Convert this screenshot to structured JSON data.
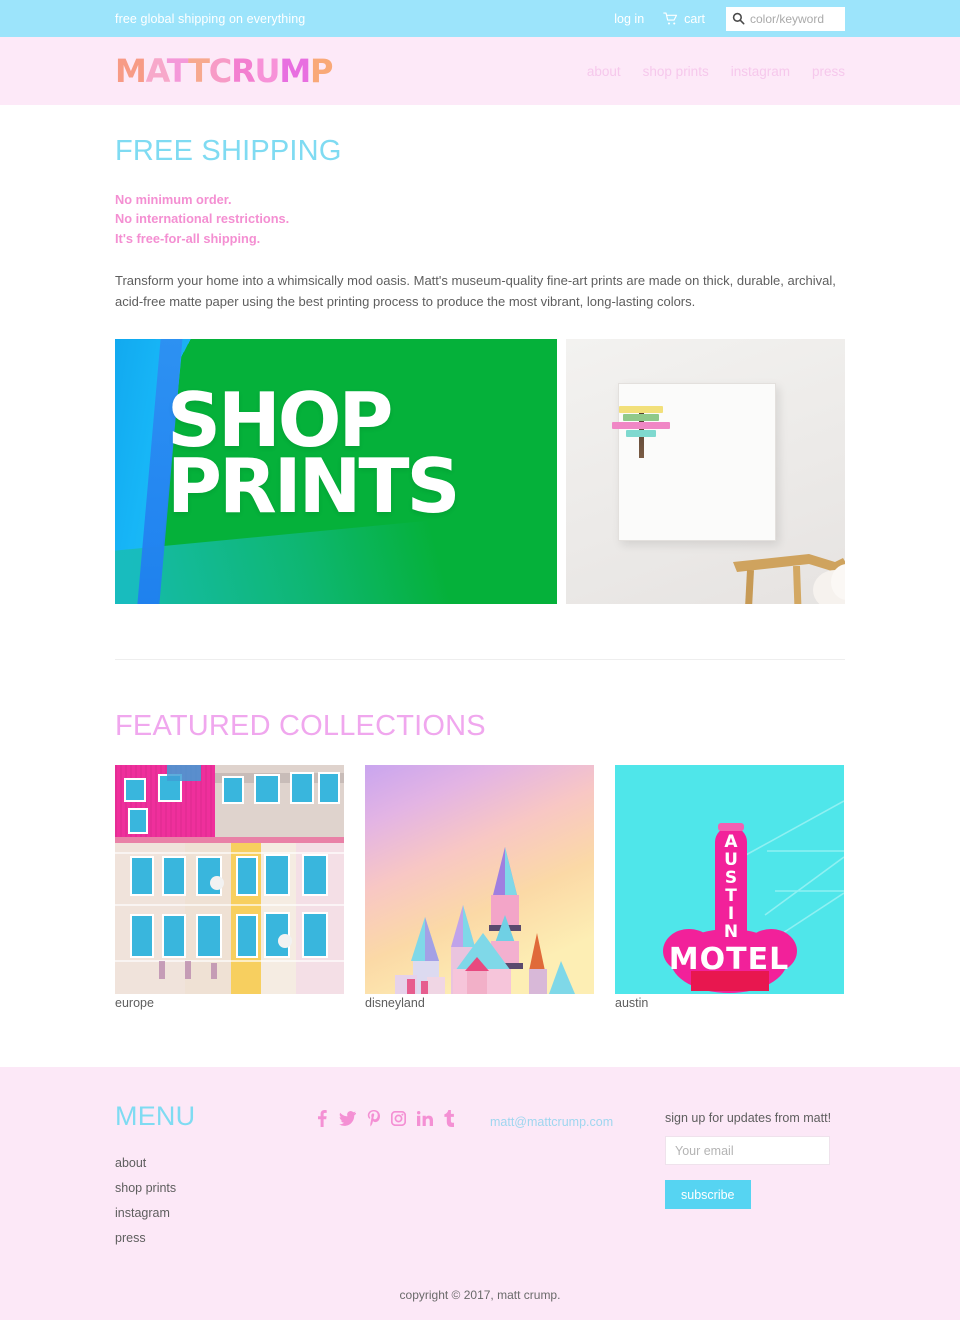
{
  "topbar": {
    "announcement": "free global shipping on everything",
    "login_label": "log in",
    "cart_label": "cart",
    "cart_icon": "shopping-cart-icon",
    "search_icon": "search-icon",
    "search_placeholder": "color/keyword",
    "search_value": "",
    "bg_color": "#9ce4fb"
  },
  "header": {
    "logo_text": "MATTCRUMP",
    "logo_letters": [
      {
        "char": "M",
        "color": "#f79b86"
      },
      {
        "char": "A",
        "color": "#f7a8ca"
      },
      {
        "char": "T",
        "color": "#f498d9"
      },
      {
        "char": "T",
        "color": "#f7a98f"
      },
      {
        "char": "C",
        "color": "#f79bc6"
      },
      {
        "char": "R",
        "color": "#f37fd0"
      },
      {
        "char": "U",
        "color": "#f792d8"
      },
      {
        "char": "M",
        "color": "#e86fe0"
      },
      {
        "char": "P",
        "color": "#f9a978"
      }
    ],
    "bg_color": "#fde9f8",
    "nav": [
      {
        "label": "about"
      },
      {
        "label": "shop prints"
      },
      {
        "label": "instagram"
      },
      {
        "label": "press"
      }
    ]
  },
  "main": {
    "page_title": "FREE SHIPPING",
    "page_title_color": "#7fdbf2",
    "promo_lines": [
      "No minimum order.",
      "No international restrictions.",
      "It's free-for-all shipping."
    ],
    "promo_color": "#f48fd2",
    "intro_paragraph": "Transform your home into a whimsically mod oasis. Matt's museum-quality fine-art prints are made on thick, durable, archival, acid-free matte paper using the best printing process to produce the most vibrant, long-lasting colors.",
    "hero": [
      {
        "name": "shop-prints-banner",
        "overlay_line_1": "SHOP",
        "overlay_line_2": "PRINTS",
        "alt": "green and blue paper background with SHOP PRINTS text"
      },
      {
        "name": "framed-print-photo",
        "alt": "framed signpost art print hanging on a white wall above a wooden chair"
      }
    ],
    "section_title": "FEATURED COLLECTIONS",
    "section_title_color": "#f0a7ee",
    "collections": [
      {
        "label": "europe",
        "alt": "colorful pink and pastel european building facade"
      },
      {
        "label": "disneyland",
        "alt": "disneyland castle against a pastel sunset gradient sky"
      },
      {
        "label": "austin",
        "alt": "pink austin motel neon sign against turquoise sky"
      }
    ]
  },
  "footer": {
    "bg_color": "#fce8f7",
    "menu_title": "MENU",
    "menu_title_color": "#7fdbf2",
    "menu_items": [
      {
        "label": "about"
      },
      {
        "label": "shop prints"
      },
      {
        "label": "instagram"
      },
      {
        "label": "press"
      }
    ],
    "socials": [
      {
        "name": "facebook-icon",
        "label": "f"
      },
      {
        "name": "twitter-icon",
        "label": "t"
      },
      {
        "name": "pinterest-icon",
        "label": "p"
      },
      {
        "name": "instagram-icon",
        "label": "ig"
      },
      {
        "name": "linkedin-icon",
        "label": "in"
      },
      {
        "name": "tumblr-icon",
        "label": "t"
      }
    ],
    "social_color": "#f490d4",
    "email": "matt@mattcrump.com",
    "email_color": "#9fd6ef",
    "newsletter_label": "sign up for updates from matt!",
    "newsletter_placeholder": "Your email",
    "newsletter_value": "",
    "subscribe_label": "subscribe",
    "subscribe_color": "#56d4f2",
    "copyright": "copyright © 2017, matt crump."
  }
}
